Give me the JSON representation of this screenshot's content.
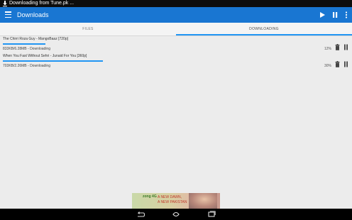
{
  "status_bar": {
    "notification_text": "Downloading from Tune.pk ..."
  },
  "app_bar": {
    "title": "Downloads"
  },
  "tabs": [
    {
      "label": "FILES",
      "active": false
    },
    {
      "label": "DOWNLOADING",
      "active": true
    }
  ],
  "downloads": [
    {
      "title": "The Chirri Roza Guy - MangoBaaz [720p]",
      "status": "833KB/6.28MB - Downloading",
      "percent_label": "12%",
      "progress": 0.12
    },
    {
      "title": "When You Fast Without Sehri - Junaid For You [360p]",
      "status": "703KB/2.26MB - Downloading",
      "percent_label": "30%",
      "progress": 0.3
    }
  ],
  "ad": {
    "brand": "zong 4G",
    "line1": "A NEW DAWN,",
    "line2": "A NEW PAKISTAN"
  },
  "colors": {
    "accent": "#2196f3",
    "app_bar": "#1976d2"
  }
}
